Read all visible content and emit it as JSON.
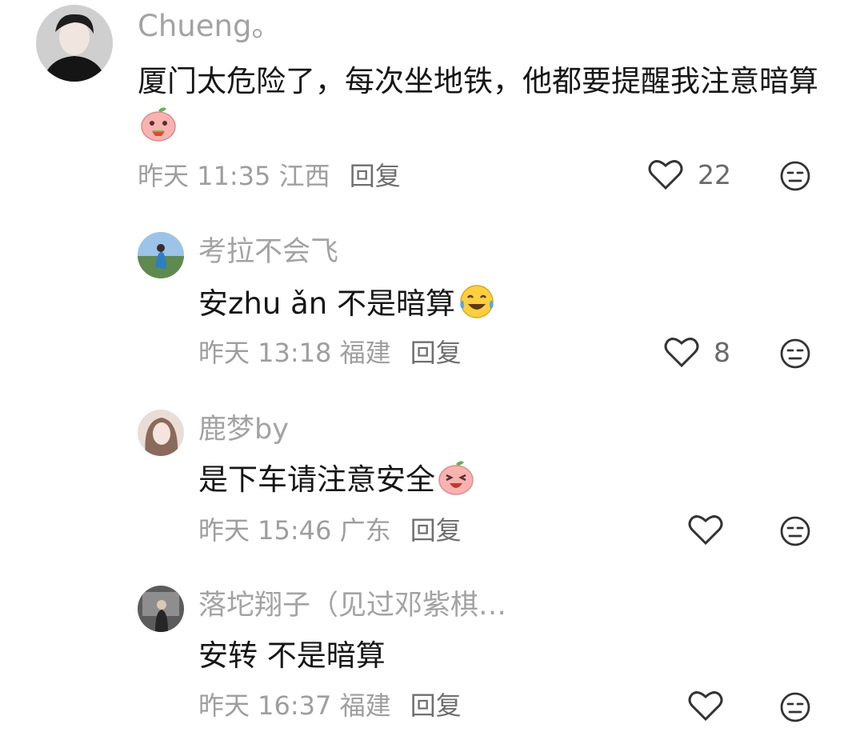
{
  "comments": [
    {
      "username": "Chueng。",
      "text": "厦门太危险了，每次坐地铁，他都要提醒我注意暗算",
      "emoji": "peach-eating-emoji",
      "time": "昨天 11:35",
      "location": "江西",
      "reply_label": "回复",
      "likes": "22"
    },
    {
      "username": "考拉不会飞",
      "text": "安zhu ǎn 不是暗算",
      "emoji": "laughing-tears-emoji",
      "time": "昨天 13:18",
      "location": "福建",
      "reply_label": "回复",
      "likes": "8"
    },
    {
      "username": "鹿梦by",
      "text": "是下车请注意安全",
      "emoji": "peach-laughing-emoji",
      "time": "昨天 15:46",
      "location": "广东",
      "reply_label": "回复",
      "likes": ""
    },
    {
      "username": "落坨翔子（见过邓紫棋…",
      "text": "安转 不是暗算",
      "emoji": "",
      "time": "昨天 16:37",
      "location": "福建",
      "reply_label": "回复",
      "likes": ""
    }
  ],
  "icons": {
    "like": "heart-outline-icon",
    "dislike": "meh-face-icon"
  }
}
